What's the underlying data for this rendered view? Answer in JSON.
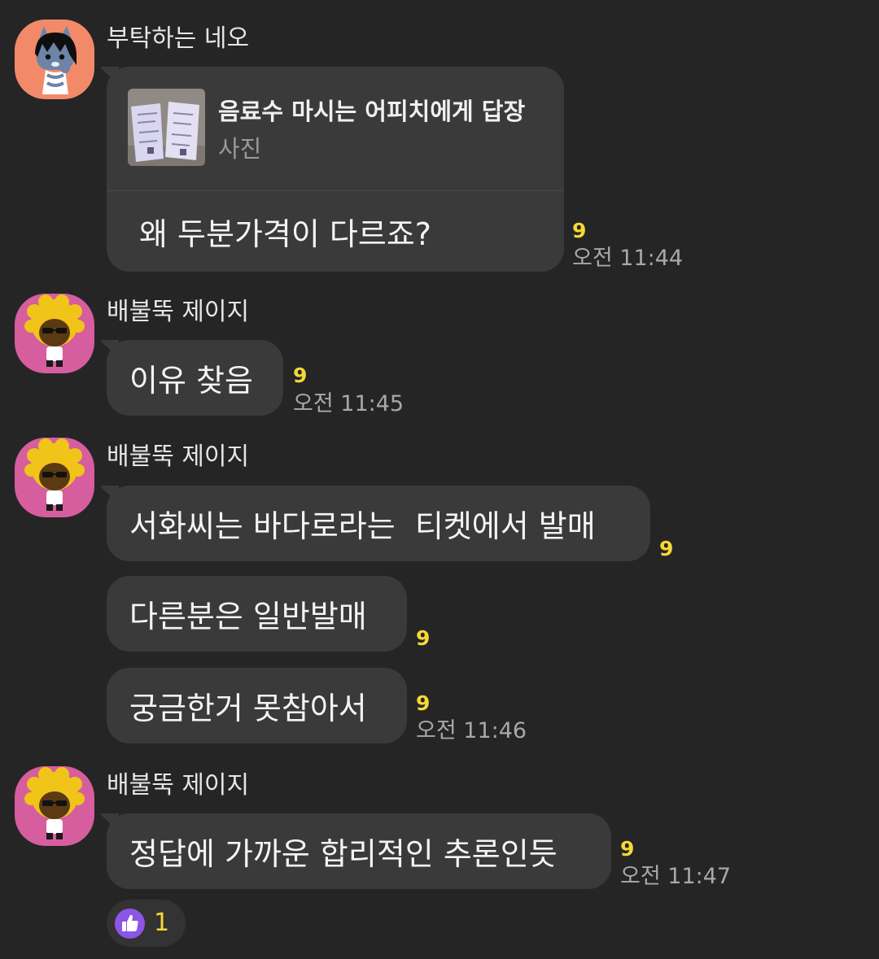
{
  "messages": [
    {
      "sender": "부탁하는 네오",
      "avatar": "neo-avatar",
      "reply": {
        "title": "음료수 마시는 어피치에게 답장",
        "subtitle": "사진",
        "thumbnail": "photo-thumbnail"
      },
      "text": "왜 두분가격이 다르죠?",
      "unread": "9",
      "time": "오전 11:44"
    },
    {
      "sender": "배불뚝 제이지",
      "avatar": "jayg-avatar",
      "text": "이유 찾음",
      "unread": "9",
      "time": "오전 11:45"
    },
    {
      "sender": "배불뚝 제이지",
      "avatar": "jayg-avatar",
      "texts": [
        {
          "text": "서화씨는 바다로라는  티켓에서 발매",
          "unread": "9"
        },
        {
          "text": "다른분은 일반발매",
          "unread": "9"
        },
        {
          "text": "궁금한거 못참아서",
          "unread": "9",
          "time": "오전 11:46"
        }
      ]
    },
    {
      "sender": "배불뚝 제이지",
      "avatar": "jayg-avatar",
      "text": "정답에 가까운 합리적인 추론인듯",
      "unread": "9",
      "time": "오전 11:47",
      "reaction": {
        "icon": "thumbs-up-icon",
        "count": "1"
      }
    }
  ],
  "colors": {
    "background": "#252525",
    "bubble": "#3a3a3a",
    "unread": "#f5d838",
    "reaction": "#8b56e6",
    "neo_avatar_bg": "#f28a6a",
    "jayg_avatar_bg": "#d65d9e"
  }
}
